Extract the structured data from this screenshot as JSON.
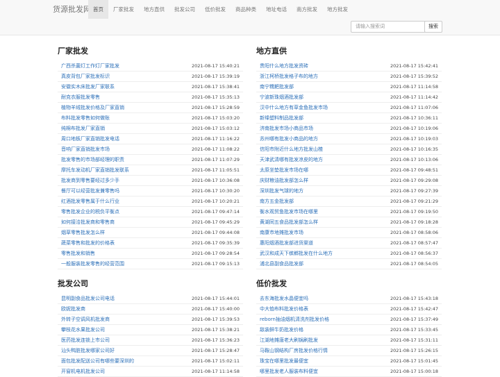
{
  "navbar": {
    "brand": "货源批发网",
    "items": [
      "首页",
      "厂家批发",
      "地方直供",
      "批发公司",
      "低价批发",
      "商品种类",
      "地址电话",
      "南方批发",
      "地方批发"
    ],
    "active_index": 0,
    "search_placeholder": "请输入搜索词",
    "search_button": "搜索"
  },
  "sections": [
    {
      "title": "厂家批发",
      "items": [
        {
          "title": "广西杀菌灯工作灯厂家批发",
          "date": "2021-08-17 15:40:21"
        },
        {
          "title": "真皮背包厂家批发标识",
          "date": "2021-08-17 15:39:19"
        },
        {
          "title": "安徽实木床批发厂家联系",
          "date": "2021-08-17 15:38:41"
        },
        {
          "title": "耐克衣服批发零售",
          "date": "2021-08-17 15:35:13"
        },
        {
          "title": "植物羊绒批发价格及厂家直销",
          "date": "2021-08-17 15:28:59"
        },
        {
          "title": "布料批发零售如何做账",
          "date": "2021-08-17 15:03:20"
        },
        {
          "title": "纯棉布批发厂家直销",
          "date": "2021-08-17 15:03:12"
        },
        {
          "title": "周口地板厂家直销批发电话",
          "date": "2021-08-17 11:16:22"
        },
        {
          "title": "音响厂家直销批发市场",
          "date": "2021-08-17 11:08:22"
        },
        {
          "title": "批发零售的市场部经理的职责",
          "date": "2021-08-17 11:07:29"
        },
        {
          "title": "摩托车发动机厂家直销批发联系",
          "date": "2021-08-17 11:05:51"
        },
        {
          "title": "批发商到零售要经过多少手",
          "date": "2021-08-17 10:36:08"
        },
        {
          "title": "餐厅可以经营批发兼零售吗",
          "date": "2021-08-17 10:30:20"
        },
        {
          "title": "红酒批发零售属于什么行业",
          "date": "2021-08-17 10:20:21"
        },
        {
          "title": "零售批发企业的税负平衡点",
          "date": "2021-08-17 09:47:14"
        },
        {
          "title": "如何接洽批发商和零售商",
          "date": "2021-08-17 09:45:29"
        },
        {
          "title": "烟草零售批发怎么样",
          "date": "2021-08-17 09:44:08"
        },
        {
          "title": "蔬菜零售和批发的价格表",
          "date": "2021-08-17 09:35:39"
        },
        {
          "title": "零售批发和销售",
          "date": "2021-08-17 09:28:54"
        },
        {
          "title": "一般服装批发零售的经营范围",
          "date": "2021-08-17 09:15:13"
        }
      ]
    },
    {
      "title": "地方直供",
      "items": [
        {
          "title": "贵阳什么地方批发资砖",
          "date": "2021-08-17 15:42:41"
        },
        {
          "title": "浙江柯桥批发格子布的地方",
          "date": "2021-08-17 15:39:52"
        },
        {
          "title": "南宁糯耙批发部",
          "date": "2021-08-17 11:14:58"
        },
        {
          "title": "宁波新珠烟酒批发部",
          "date": "2021-08-17 11:14:42"
        },
        {
          "title": "汉中什么地方有草金鱼批发市场",
          "date": "2021-08-17 11:07:06"
        },
        {
          "title": "新绛塑料制品批发部",
          "date": "2021-08-17 10:36:11"
        },
        {
          "title": "济南批发市场小商品市场",
          "date": "2021-08-17 10:19:06"
        },
        {
          "title": "苏州哪有批发小商品的地方",
          "date": "2021-08-17 10:19:03"
        },
        {
          "title": "信阳市附近什么地方批发山楂",
          "date": "2021-08-17 10:16:35"
        },
        {
          "title": "天津武清哪有批发凉皮的地方",
          "date": "2021-08-17 10:13:06"
        },
        {
          "title": "太原坐垫批发市场在哪",
          "date": "2021-08-17 09:48:51"
        },
        {
          "title": "庆财粮油批发部怎么样",
          "date": "2021-08-17 09:29:08"
        },
        {
          "title": "深圳批发气球的地方",
          "date": "2021-08-17 09:27:39"
        },
        {
          "title": "南方五金批发部",
          "date": "2021-08-17 09:21:29"
        },
        {
          "title": "衡水观贸鱼批发市场在哪里",
          "date": "2021-08-17 09:19:50"
        },
        {
          "title": "黄湖同五食品批发部怎么样",
          "date": "2021-08-17 09:18:28"
        },
        {
          "title": "南康市地摊批发市场",
          "date": "2021-08-17 08:58:06"
        },
        {
          "title": "惠阳烟酒批发部进货渠道",
          "date": "2021-08-17 08:57:47"
        },
        {
          "title": "武汉和成天下槟榔批发在什么地方",
          "date": "2021-08-17 08:56:37"
        },
        {
          "title": "浦北县副食品批发部",
          "date": "2021-08-17 08:54:05"
        }
      ]
    },
    {
      "title": "批发公司",
      "items": [
        {
          "title": "昆明副食品批发公司电话",
          "date": "2021-08-17 15:44:01"
        },
        {
          "title": "欧妮批发商",
          "date": "2021-08-17 15:40:00"
        },
        {
          "title": "外转子空调风机批发商",
          "date": "2021-08-17 15:39:53"
        },
        {
          "title": "攀枝花水果批发公司",
          "date": "2021-08-17 15:38:21"
        },
        {
          "title": "医药批发连锁上市公司",
          "date": "2021-08-17 15:36:23"
        },
        {
          "title": "汕头鸭脏批发哪家公司好",
          "date": "2021-08-17 15:28:47"
        },
        {
          "title": "面包批发配送公司有哪些要深圳的",
          "date": "2021-08-17 15:02:11"
        },
        {
          "title": "开窗机电机批发公司",
          "date": "2021-08-17 11:14:58"
        }
      ]
    },
    {
      "title": "低价批发",
      "items": [
        {
          "title": "去东海批发水晶便宜吗",
          "date": "2021-08-17 15:43:18"
        },
        {
          "title": "中大恤布料批发价格表",
          "date": "2021-08-17 15:42:47"
        },
        {
          "title": "reborn抽油烟机清洗剂批发价格",
          "date": "2021-08-17 15:37:49"
        },
        {
          "title": "敌装鲜牛奶批发价格",
          "date": "2021-08-17 15:33:45"
        },
        {
          "title": "江湖地摊唐老大刷锅刷批发",
          "date": "2021-08-17 15:31:11"
        },
        {
          "title": "马鞍山钢结构厂房批发价格行情",
          "date": "2021-08-17 15:26:15"
        },
        {
          "title": "珠宝在哪里批发最便宜",
          "date": "2021-08-17 15:01:45"
        },
        {
          "title": "哪里批发老人服装布料便宜",
          "date": "2021-08-17 15:00:18"
        }
      ]
    }
  ]
}
